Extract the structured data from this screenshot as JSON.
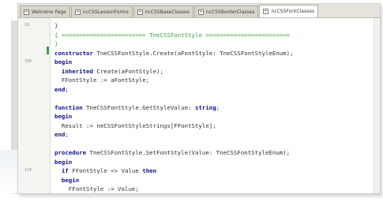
{
  "tabs": [
    {
      "label": "Welcome Page",
      "active": false
    },
    {
      "label": "ncCSSLessonForms",
      "active": false
    },
    {
      "label": "ncCSSBaseClasses",
      "active": false
    },
    {
      "label": "ncCSSBorderClasses",
      "active": false
    },
    {
      "label": "ncCSSFontClasses",
      "active": true
    }
  ],
  "line_numbers": [
    "10",
    "",
    "",
    "",
    "100",
    "",
    "",
    "",
    "",
    "",
    "",
    "",
    "",
    "",
    "",
    "",
    "110",
    "",
    "",
    "",
    ""
  ],
  "code_lines": [
    [
      {
        "t": "}",
        "c": ""
      }
    ],
    [
      {
        "t": "{ ",
        "c": "cm"
      },
      {
        "t": "======================== TneCSSFontStyle ========================",
        "c": "cm"
      }
    ],
    [
      {
        "t": "}",
        "c": "cm"
      }
    ],
    [
      {
        "t": "constructor",
        "c": "kw"
      },
      {
        "t": " TneCSSFontStyle.Create(aFontStyle: TneCSSFontStyleEnum);",
        "c": ""
      }
    ],
    [
      {
        "t": "begin",
        "c": "kw"
      }
    ],
    [
      {
        "t": "  ",
        "c": ""
      },
      {
        "t": "inherited",
        "c": "kw"
      },
      {
        "t": " Create(aFontStyle);",
        "c": ""
      }
    ],
    [
      {
        "t": "  FFontStyle := aFontStyle;",
        "c": ""
      }
    ],
    [
      {
        "t": "end",
        "c": "kw"
      },
      {
        "t": ";",
        "c": ""
      }
    ],
    [
      {
        "t": "",
        "c": ""
      }
    ],
    [
      {
        "t": "function",
        "c": "kw"
      },
      {
        "t": " TneCSSFontStyle.GetStyleValue: ",
        "c": ""
      },
      {
        "t": "string",
        "c": "kw"
      },
      {
        "t": ";",
        "c": ""
      }
    ],
    [
      {
        "t": "begin",
        "c": "kw"
      }
    ],
    [
      {
        "t": "  Result := neCSSFontStyleStrings[FFontStyle];",
        "c": ""
      }
    ],
    [
      {
        "t": "end",
        "c": "kw"
      },
      {
        "t": ";",
        "c": ""
      }
    ],
    [
      {
        "t": "",
        "c": ""
      }
    ],
    [
      {
        "t": "procedure",
        "c": "kw"
      },
      {
        "t": " TneCSSFontStyle.SetFontStyle(Value: TneCSSFontStyleEnum);",
        "c": ""
      }
    ],
    [
      {
        "t": "begin",
        "c": "kw"
      }
    ],
    [
      {
        "t": "  ",
        "c": ""
      },
      {
        "t": "if",
        "c": "kw"
      },
      {
        "t": " FFontStyle <> Value ",
        "c": ""
      },
      {
        "t": "then",
        "c": "kw"
      }
    ],
    [
      {
        "t": "  ",
        "c": ""
      },
      {
        "t": "begin",
        "c": "kw"
      }
    ],
    [
      {
        "t": "    FFontStyle := Value;",
        "c": ""
      }
    ]
  ]
}
